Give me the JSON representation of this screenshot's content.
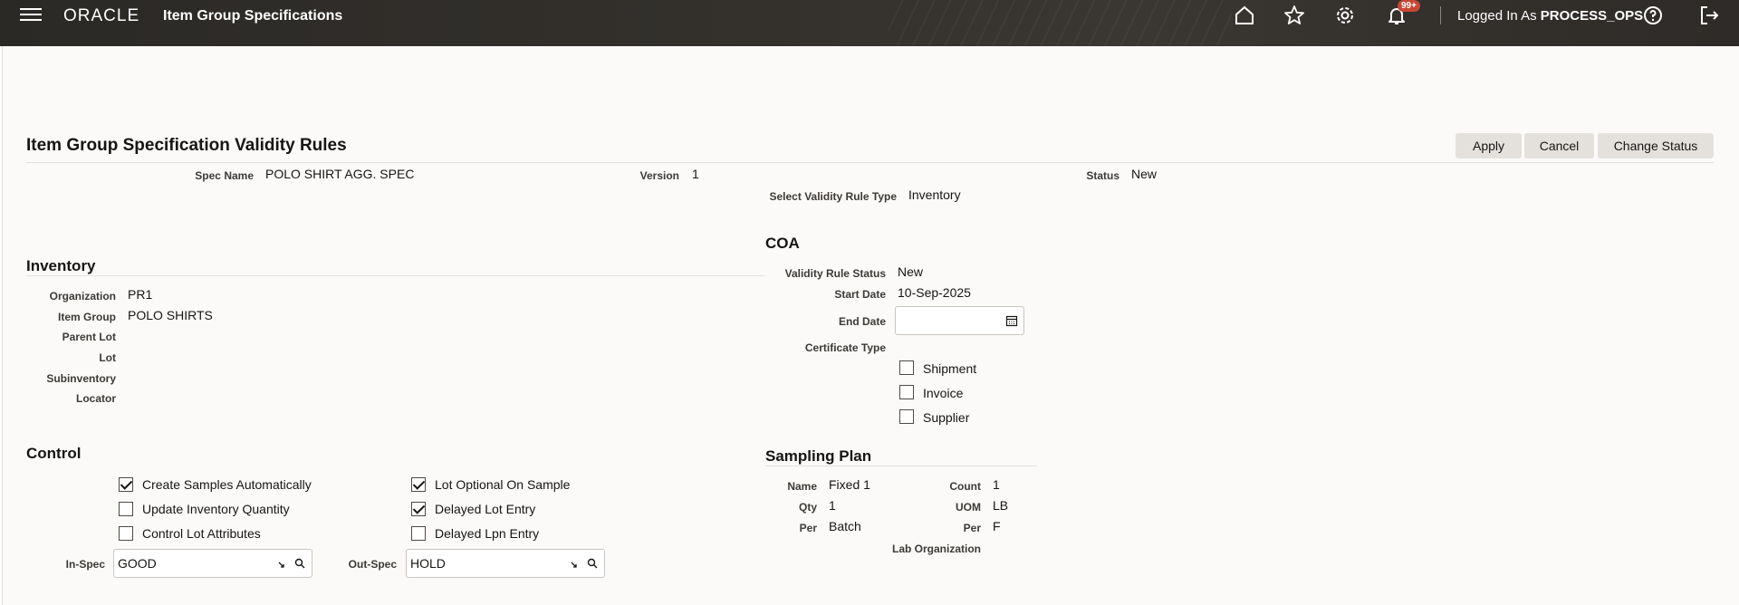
{
  "header": {
    "logo": "ORACLE",
    "app_title": "Item Group Specifications",
    "notifications_badge": "99+",
    "logged_in_prefix": "Logged In As",
    "logged_in_user": "PROCESS_OPS",
    "icons": [
      "home-icon",
      "star-icon",
      "gear-icon",
      "bell-icon",
      "help-icon",
      "sign-out-icon"
    ]
  },
  "page": {
    "title": "Item Group Specification Validity Rules",
    "buttons": {
      "apply": "Apply",
      "cancel": "Cancel",
      "change_status": "Change Status"
    },
    "spec_name_label": "Spec Name",
    "spec_name": "POLO SHIRT AGG. SPEC",
    "version_label": "Version",
    "version": "1",
    "status_label": "Status",
    "status": "New",
    "rule_type_label": "Select Validity Rule Type",
    "rule_type": "Inventory"
  },
  "inventory": {
    "title": "Inventory",
    "organization_label": "Organization",
    "organization": "PR1",
    "item_group_label": "Item Group",
    "item_group": "POLO SHIRTS",
    "parent_lot_label": "Parent Lot",
    "lot_label": "Lot",
    "subinventory_label": "Subinventory",
    "locator_label": "Locator"
  },
  "control": {
    "title": "Control",
    "checkboxes": [
      {
        "label": "Create Samples Automatically",
        "checked": true
      },
      {
        "label": "Update Inventory Quantity",
        "checked": false
      },
      {
        "label": "Control Lot Attributes",
        "checked": false
      },
      {
        "label": "Lot Optional On Sample",
        "checked": true
      },
      {
        "label": "Delayed Lot Entry",
        "checked": true
      },
      {
        "label": "Delayed Lpn Entry",
        "checked": false
      }
    ],
    "in_spec_label": "In-Spec",
    "in_spec": "GOOD",
    "out_spec_label": "Out-Spec",
    "out_spec": "HOLD"
  },
  "coa": {
    "title": "COA",
    "rule_status_label": "Validity Rule Status",
    "rule_status": "New",
    "start_date_label": "Start Date",
    "start_date": "10-Sep-2025",
    "end_date_label": "End Date",
    "end_date": "",
    "certificate_type_label": "Certificate Type",
    "certificates": [
      {
        "label": "Shipment",
        "checked": false
      },
      {
        "label": "Invoice",
        "checked": false
      },
      {
        "label": "Supplier",
        "checked": false
      }
    ]
  },
  "sampling": {
    "title": "Sampling Plan",
    "name_label": "Name",
    "name": "Fixed 1",
    "count_label": "Count",
    "count": "1",
    "qty_label": "Qty",
    "qty": "1",
    "uom_label": "UOM",
    "uom": "LB",
    "per_label": "Per",
    "per": "Batch",
    "per2_label": "Per",
    "per2": "F",
    "lab_org_label": "Lab Organization"
  }
}
